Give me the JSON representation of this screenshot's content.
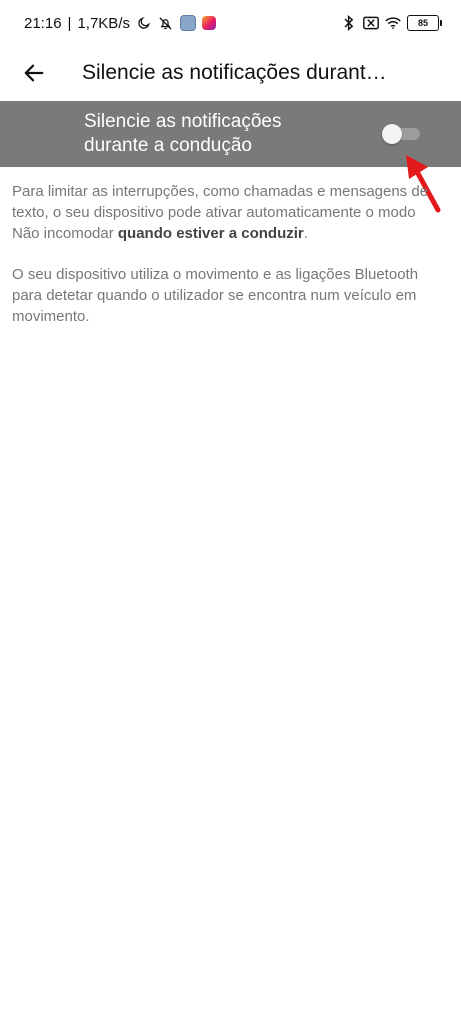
{
  "status_bar": {
    "time": "21:16",
    "separator": "|",
    "speed": "1,7KB/s",
    "battery": "85",
    "icons": [
      "moon-icon",
      "bell-off-icon",
      "app-icon",
      "instagram-icon",
      "bluetooth-icon",
      "no-sim-icon",
      "wifi-icon",
      "battery-icon"
    ]
  },
  "app_bar": {
    "title": "Silencie as notificações durant…",
    "back_icon": "arrow-left-icon"
  },
  "setting": {
    "label": "Silencie as notificações durante a condução",
    "toggle_state": "off",
    "row_color": "#7a7a7a",
    "annotation_color": "#e3191c"
  },
  "description": {
    "paragraph1_plain": "Para limitar as interrupções, como chamadas e mensagens de texto, o seu dispositivo pode ativar automaticamente o modo Não incomodar ",
    "paragraph1_bold": "quando estiver a conduzir",
    "paragraph1_end": ".",
    "paragraph2": "O seu dispositivo utiliza o movimento e as ligações Bluetooth para detetar quando o utilizador se encontra num veículo em movimento."
  }
}
